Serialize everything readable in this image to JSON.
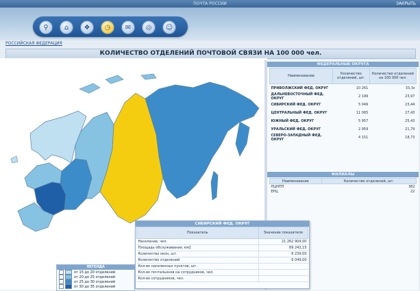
{
  "window": {
    "title": "ПОЧТА РОССИИ",
    "close_label": "ЗАКРЫТЬ"
  },
  "nav": {
    "icons": [
      "search-icon",
      "home-icon",
      "network-icon",
      "clock-icon",
      "mail-icon",
      "globe-icon",
      "user-icon"
    ]
  },
  "breadcrumb": "РОССИЙСКАЯ ФЕДЕРАЦИЯ",
  "page_title": "КОЛИЧЕСТВО ОТДЕЛЕНИЙ ПОЧТОВОЙ СВЯЗИ НА 100 000 чел.",
  "federal": {
    "title": "ФЕДЕРАЛЬНЫЕ ОКРУГА",
    "headers": [
      "Наименование",
      "Количество отделений, шт.",
      "Количество отделений на 100 000 чел."
    ],
    "rows": [
      {
        "name": "ПРИВОЛЖСКИЙ ФЕД. ОКРУГ",
        "count": "10 261",
        "per": "33,3s"
      },
      {
        "name": "ДАЛЬНЕВОСТОЧНЫЙ ФЕД. ОКРУГ",
        "count": "2 199",
        "per": "23,97"
      },
      {
        "name": "СИБИРСКИЙ ФЕД. ОКРУГ",
        "count": "5 049",
        "per": "23,44"
      },
      {
        "name": "ЦЕНТРАЛЬНЫЙ ФЕД. ОКРУГ",
        "count": "11 065",
        "per": "27,43"
      },
      {
        "name": "ЮЖНЫЙ ФЕД. ОКРУГ",
        "count": "5 957",
        "per": "25,43"
      },
      {
        "name": "УРАЛЬСКИЙ ФЕД. ОКРУГ",
        "count": "2 959",
        "per": "21,79"
      },
      {
        "name": "СЕВЕРО-ЗАПАДНЫЙ ФЕД. ОКРУГ",
        "count": "4 151",
        "per": "18,73"
      }
    ]
  },
  "branches": {
    "title": "ФИЛИАЛЫ",
    "headers": [
      "Наименование",
      "Количество отделений, шт."
    ],
    "rows": [
      {
        "name": "ПЦНПП",
        "count": "382"
      },
      {
        "name": "ЕРЦ",
        "count": "22"
      }
    ]
  },
  "popup": {
    "title": "СИБИРСКИЙ ФЕД. ОКРУГ",
    "headers": [
      "Показатель",
      "Значение показателя"
    ],
    "rows": [
      {
        "label": "Население, чел.",
        "value": "21 262 904,00"
      },
      {
        "label": "Площадь обслуживания, км2",
        "value": "89 242,15"
      },
      {
        "label": "Количество окон, шт.",
        "value": "8 239,00"
      },
      {
        "label": "Количество отделений",
        "value": "6 049,00"
      },
      {
        "label": "Кол-во населенных пунктов, шт.",
        "value": ""
      },
      {
        "label": "Кол-во почтальонов на сотрудников, чел.",
        "value": ""
      },
      {
        "label": "Кол-во сотрудников, чел.",
        "value": ""
      }
    ]
  },
  "legend": {
    "title": "ЛЕГЕНДА",
    "items": [
      {
        "label": "от 15 до 20 отделений",
        "color": "#bfe0f0"
      },
      {
        "label": "от 20 до 25 отделений",
        "color": "#86c3e3"
      },
      {
        "label": "от 25 до 30 отделений",
        "color": "#3c8cc9"
      },
      {
        "label": "от 30 до 35 отделений",
        "color": "#1f5fa8"
      }
    ]
  },
  "map_colors": {
    "selected": "#f5cd10",
    "c1": "#bfe0f0",
    "c2": "#86c3e3",
    "c3": "#3c8cc9",
    "c4": "#1f5fa8"
  }
}
